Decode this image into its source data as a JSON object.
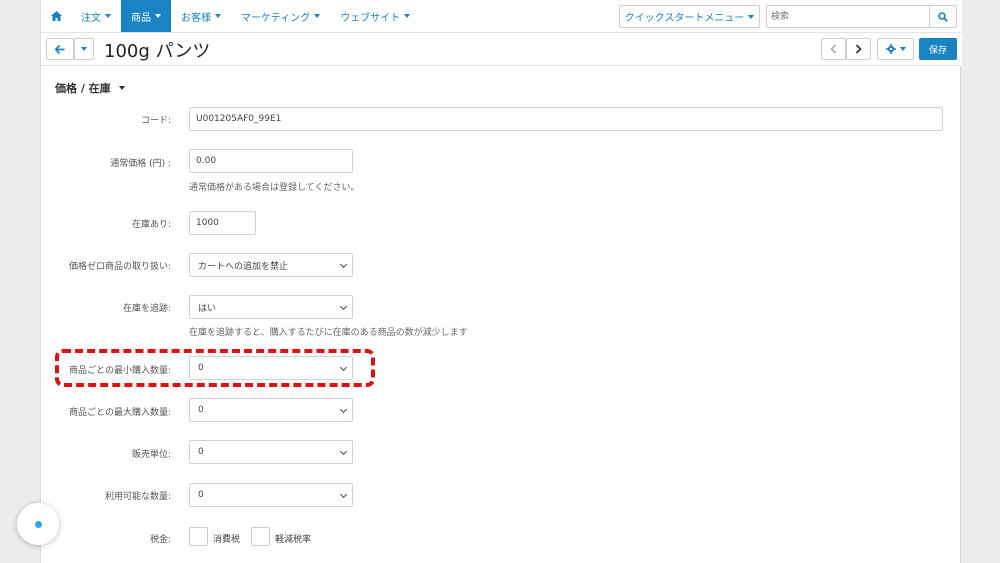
{
  "nav": {
    "items": [
      {
        "label": "注文",
        "active": false
      },
      {
        "label": "商品",
        "active": true
      },
      {
        "label": "お客様",
        "active": false
      },
      {
        "label": "マーケティング",
        "active": false
      },
      {
        "label": "ウェブサイト",
        "active": false
      }
    ],
    "quick_menu": "クイックスタートメニュー",
    "search_placeholder": "検索"
  },
  "title_bar": {
    "title": "100g パンツ",
    "save_label": "保存"
  },
  "section": {
    "title": "価格 / 在庫"
  },
  "form": {
    "code": {
      "label": "コード:",
      "value": "U001205AF0_99E1"
    },
    "list_price": {
      "label": "通常価格 (円) :",
      "value": "0.00",
      "help": "通常価格がある場合は登録してください。"
    },
    "stock": {
      "label": "在庫あり:",
      "value": "1000"
    },
    "zero_price": {
      "label": "価格ゼロ商品の取り扱い:",
      "value": "カートへの追加を禁止"
    },
    "track_stock": {
      "label": "在庫を追跡:",
      "value": "はい",
      "help": "在庫を追跡すると、購入するたびに在庫のある商品の数が減少します"
    },
    "min_qty": {
      "label": "商品ごとの最小購入数量:",
      "value": "0"
    },
    "max_qty": {
      "label": "商品ごとの最大購入数量:",
      "value": "0"
    },
    "unit": {
      "label": "販売単位:",
      "value": "0"
    },
    "available_qty": {
      "label": "利用可能な数量:",
      "value": "0"
    },
    "tax": {
      "label": "税金:",
      "options": [
        "消費税",
        "軽減税率"
      ]
    }
  },
  "colors": {
    "accent": "#1a83c4",
    "highlight": "#e01010"
  }
}
